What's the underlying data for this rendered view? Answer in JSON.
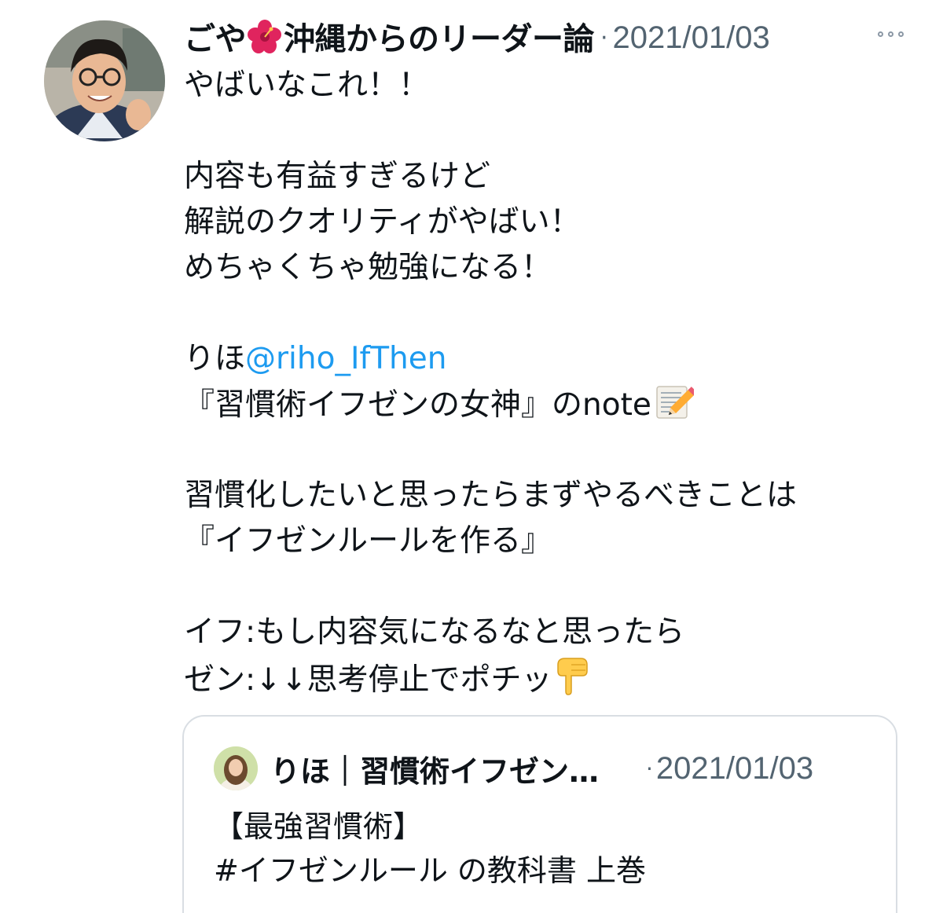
{
  "tweet": {
    "display_name_prefix": "ごや",
    "display_name_suffix": "沖縄からのリーダー論",
    "separator": "·",
    "timestamp": "2021/01/03",
    "flower_icon": "hibiscus-icon",
    "more_icon": "more-options-icon",
    "text_lines": {
      "l1": "やばいなこれ！！",
      "l2": "内容も有益すぎるけど",
      "l3": "解説のクオリティがやばい！",
      "l4": "めちゃくちゃ勉強になる！",
      "l5_prefix": "りほ",
      "l5_mention": "@riho_IfThen",
      "l6": "『習慣術イフゼンの女神』のnote",
      "l7": "習慣化したいと思ったらまずやるべきことは",
      "l8": "『イフゼンルールを作る』",
      "l9": "イフ:もし内容気になるなと思ったら",
      "l10": "ゼン:↓↓思考停止でポチッ"
    },
    "memo_icon": "memo-pencil-icon",
    "pointing_icon": "pointing-down-icon"
  },
  "quote": {
    "name": "りほ｜習慣術イフゼン…",
    "separator": "·",
    "timestamp": "2021/01/03",
    "line1": "【最強習慣術】",
    "line2": "#イフゼンルール の教科書 上巻"
  },
  "colors": {
    "link": "#1d9bf0",
    "secondary_text": "#536471",
    "border": "#d9dee3"
  }
}
